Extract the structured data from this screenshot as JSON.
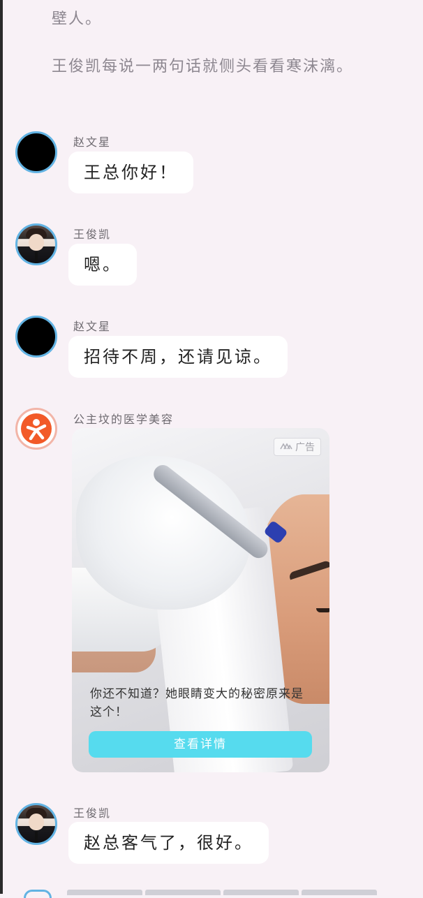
{
  "narration": {
    "line1": "壁人。",
    "line2": "王俊凯每说一两句话就侧头看看寒沫漓。"
  },
  "messages": [
    {
      "sender": "赵文星",
      "text": "王总你好！"
    },
    {
      "sender": "王俊凯",
      "text": "嗯。"
    },
    {
      "sender": "赵文星",
      "text": "招待不周，还请见谅。"
    },
    {
      "sender": "王俊凯",
      "text": "赵总客气了，很好。"
    }
  ],
  "ad": {
    "sender": "公主坟的医学美容",
    "badge": "广告",
    "caption": "你还不知道？她眼睛变大的秘密原来是这个！",
    "button": "查看详情"
  },
  "colors": {
    "background": "#f8f1f6",
    "avatar_ring": "#62b3e3",
    "ad_button": "#56dbee",
    "brand_orange": "#f25a28"
  }
}
